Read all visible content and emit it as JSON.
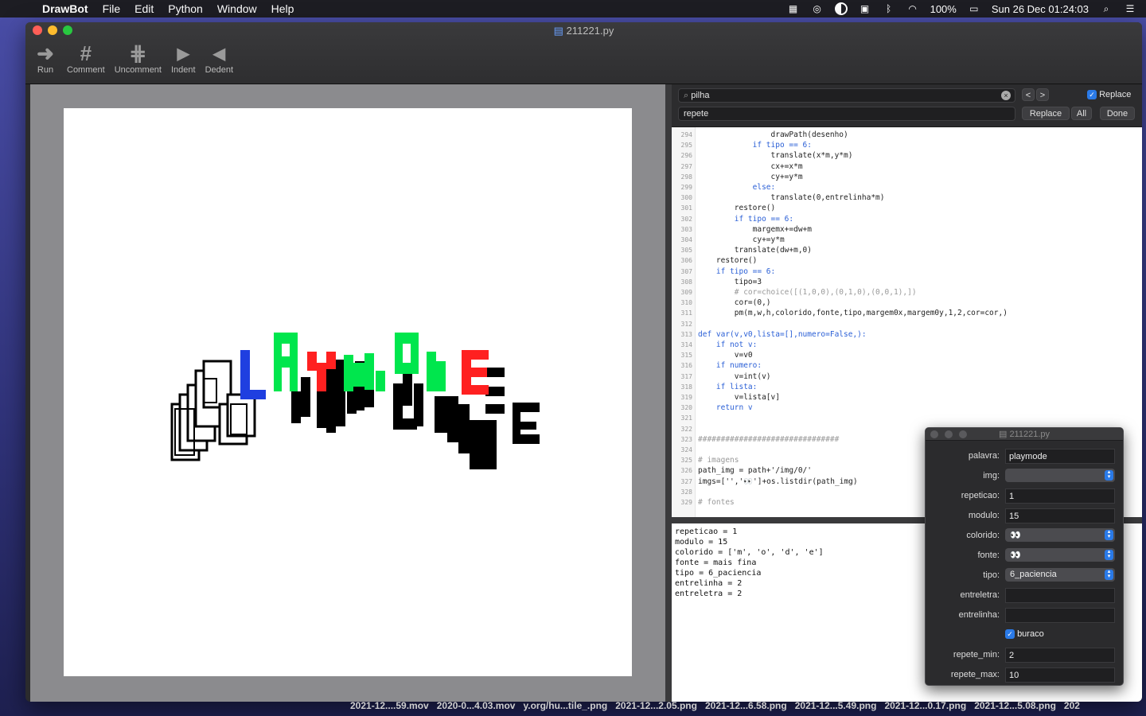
{
  "menubar": {
    "app": "DrawBot",
    "items": [
      "File",
      "Edit",
      "Python",
      "Window",
      "Help"
    ],
    "battery": "100%",
    "datetime": "Sun 26 Dec  01:24:03"
  },
  "window": {
    "title": "211221.py",
    "toolbar": [
      {
        "label": "Run",
        "icon": "arrow-right-icon"
      },
      {
        "label": "Comment",
        "icon": "hash-icon"
      },
      {
        "label": "Uncomment",
        "icon": "hash-broken-icon"
      },
      {
        "label": "Indent",
        "icon": "triangle-right-icon"
      },
      {
        "label": "Dedent",
        "icon": "triangle-left-icon"
      }
    ]
  },
  "find": {
    "search_value": "pilha",
    "replace_value": "repete",
    "replace_checkbox_label": "Replace",
    "replace_button": "Replace",
    "all_button": "All",
    "done_button": "Done",
    "prev": "<",
    "next": ">"
  },
  "editor": {
    "lines": [
      {
        "n": "294",
        "text": "                drawPath(desenho)"
      },
      {
        "n": "295",
        "text": "            if tipo == 6:"
      },
      {
        "n": "296",
        "text": "                translate(x*m,y*m)"
      },
      {
        "n": "297",
        "text": "                cx+=x*m"
      },
      {
        "n": "298",
        "text": "                cy+=y*m"
      },
      {
        "n": "299",
        "text": "            else:"
      },
      {
        "n": "300",
        "text": "                translate(0,entrelinha*m)"
      },
      {
        "n": "301",
        "text": "        restore()"
      },
      {
        "n": "302",
        "text": "        if tipo == 6:"
      },
      {
        "n": "303",
        "text": "            margemx+=dw+m"
      },
      {
        "n": "304",
        "text": "            cy+=y*m"
      },
      {
        "n": "305",
        "text": "        translate(dw+m,0)"
      },
      {
        "n": "306",
        "text": "    restore()"
      },
      {
        "n": "307",
        "text": "    if tipo == 6:"
      },
      {
        "n": "308",
        "text": "        tipo=3"
      },
      {
        "n": "309",
        "text": "        # cor=choice([(1,0,0),(0,1,0),(0,0,1),])"
      },
      {
        "n": "310",
        "text": "        cor=(0,)"
      },
      {
        "n": "311",
        "text": "        pm(m,w,h,colorido,fonte,tipo,margem0x,margem0y,1,2,cor=cor,)"
      },
      {
        "n": "312",
        "text": ""
      },
      {
        "n": "313",
        "text": "def var(v,v0,lista=[],numero=False,):"
      },
      {
        "n": "314",
        "text": "    if not v:"
      },
      {
        "n": "315",
        "text": "        v=v0"
      },
      {
        "n": "316",
        "text": "    if numero:"
      },
      {
        "n": "317",
        "text": "        v=int(v)"
      },
      {
        "n": "318",
        "text": "    if lista:"
      },
      {
        "n": "319",
        "text": "        v=lista[v]"
      },
      {
        "n": "320",
        "text": "    return v"
      },
      {
        "n": "321",
        "text": ""
      },
      {
        "n": "322",
        "text": ""
      },
      {
        "n": "323",
        "text": "###############################"
      },
      {
        "n": "324",
        "text": ""
      },
      {
        "n": "325",
        "text": "# imagens"
      },
      {
        "n": "326",
        "text": "path_img = path+'/img/0/'"
      },
      {
        "n": "327",
        "text": "imgs=['','👀']+os.listdir(path_img)"
      },
      {
        "n": "328",
        "text": ""
      },
      {
        "n": "329",
        "text": "# fontes"
      }
    ]
  },
  "output": {
    "lines": [
      "repeticao = 1",
      "modulo = 15",
      "colorido = ['m', 'o', 'd', 'e']",
      "fonte = mais fina",
      "tipo = 6_paciencia",
      "entrelinha = 2",
      "entreletra = 2"
    ]
  },
  "variables": {
    "title": "211221.py",
    "rows": [
      {
        "label": "palavra:",
        "kind": "field",
        "value": "playmode"
      },
      {
        "label": "img:",
        "kind": "select",
        "value": ""
      },
      {
        "label": "repeticao:",
        "kind": "field",
        "value": "1"
      },
      {
        "label": "modulo:",
        "kind": "field",
        "value": "15"
      },
      {
        "label": "colorido:",
        "kind": "select",
        "value": "👀"
      },
      {
        "label": "fonte:",
        "kind": "select",
        "value": "👀"
      },
      {
        "label": "tipo:",
        "kind": "select",
        "value": "6_paciencia"
      },
      {
        "label": "entreletra:",
        "kind": "field",
        "value": ""
      },
      {
        "label": "entrelinha:",
        "kind": "field",
        "value": ""
      },
      {
        "label": "buraco",
        "kind": "checkbox",
        "value": "checked"
      },
      {
        "label": "repete_min:",
        "kind": "field",
        "value": "2"
      },
      {
        "label": "repete_max:",
        "kind": "field",
        "value": "10"
      }
    ]
  },
  "dock_labels": [
    "2021-12....59.mov",
    "2020-0...4.03.mov",
    "y.org/hu...tile_.png",
    "2021-12...2.05.png",
    "2021-12...6.58.png",
    "2021-12...5.49.png",
    "2021-12...0.17.png",
    "2021-12...5.08.png",
    "202"
  ],
  "colors": {
    "accent": "#2a7ae8",
    "art_blue": "#1f3fe0",
    "art_green": "#00e64d",
    "art_red": "#ff2020"
  }
}
